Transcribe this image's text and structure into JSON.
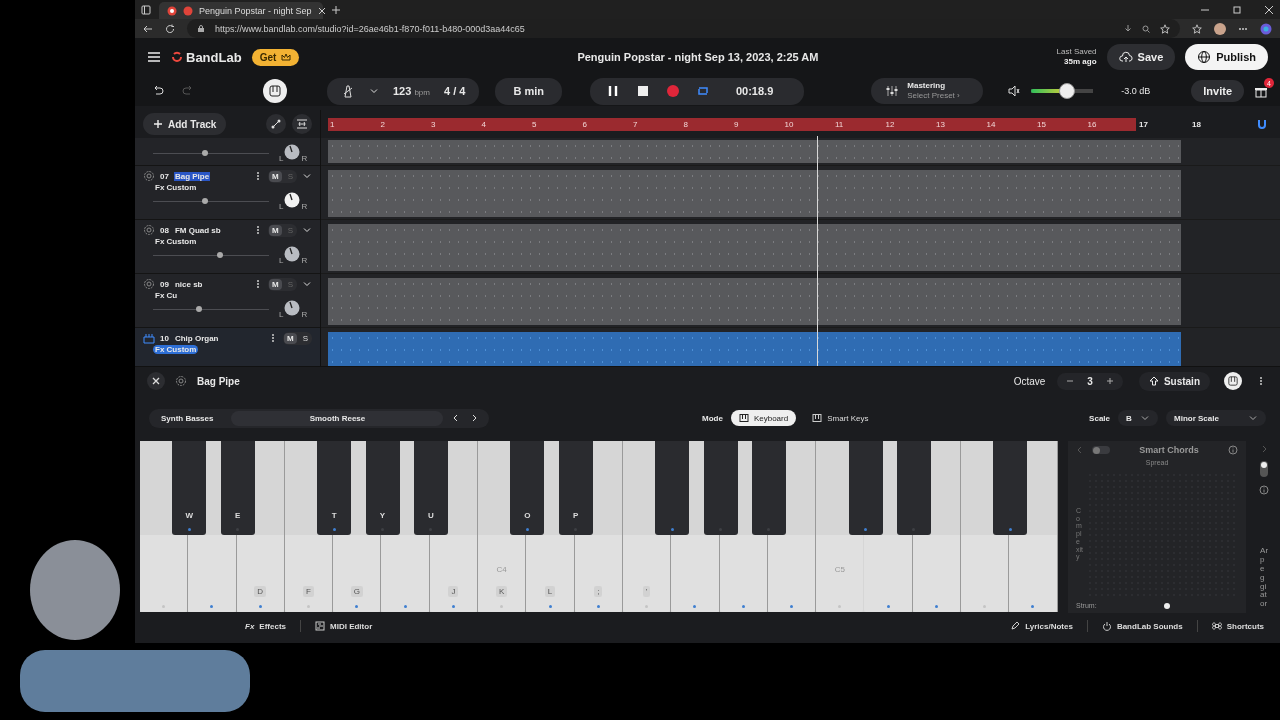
{
  "browser": {
    "tab_title": "Penguin Popstar - night Sep",
    "url": "https://www.bandlab.com/studio?id=26ae46b1-f870-f011-b480-000d3aa44c65"
  },
  "header": {
    "brand": "BandLab",
    "get_badge": "Get",
    "title": "Penguin Popstar - night Sep 13, 2023, 2:25 AM",
    "last_saved_label": "Last Saved",
    "last_saved_time": "35m ago",
    "save": "Save",
    "publish": "Publish"
  },
  "transport": {
    "tempo": "123",
    "tempo_unit": "bpm",
    "time_signature": "4 / 4",
    "key": "B min",
    "playing": true,
    "loop": true,
    "time": "00:18.9",
    "mastering_title": "Mastering",
    "mastering_preset": "Select Preset ›",
    "volume": {
      "level": 0.58
    },
    "volume_reading": "-3.0 dB",
    "invite": "Invite",
    "notification_count": "4"
  },
  "add_track": "Add Track",
  "tracks": [
    {
      "selected": false,
      "level": 0.45,
      "pan_left": "L",
      "pan_right": "R"
    },
    {
      "kind": "synth",
      "number": "07",
      "name": "Bag Pipe",
      "name_highlighted": true,
      "fx": "Fx Custom",
      "mute": "M",
      "solo": "S",
      "selected": false,
      "level": 0.45,
      "pan_left": "L",
      "pan_right": "R"
    },
    {
      "kind": "synth",
      "number": "08",
      "name": "FM Quad sb",
      "name_highlighted": false,
      "fx": "Fx Custom",
      "mute": "M",
      "solo": "S",
      "selected": false,
      "level": 0.58,
      "pan_left": "L",
      "pan_right": "R"
    },
    {
      "kind": "synth",
      "number": "09",
      "name": "nice sb",
      "name_highlighted": false,
      "fx": "Fx Cu",
      "mute": "M",
      "solo": "S",
      "selected": false,
      "level": 0.4,
      "pan_left": "L",
      "pan_right": "R"
    },
    {
      "kind": "instrument",
      "number": "10",
      "name": "Chip Organ",
      "name_highlighted": false,
      "fx": "Fx Custom",
      "mute": "M",
      "solo": "S",
      "selected": true
    }
  ],
  "ruler": {
    "loop": true,
    "bars": [
      "1",
      "2",
      "3",
      "4",
      "5",
      "6",
      "7",
      "8",
      "9",
      "10",
      "11",
      "12",
      "13",
      "14",
      "15",
      "16"
    ],
    "after": [
      "17",
      "18"
    ]
  },
  "instrument_panel": {
    "name": "Bag Pipe",
    "octave_label": "Octave",
    "octave": "3",
    "sustain": "Sustain",
    "preset_category": "Synth Basses",
    "preset": "Smooth Reese",
    "mode_label": "Mode",
    "modes": [
      {
        "label": "Keyboard",
        "selected": true
      },
      {
        "label": "Smart Keys",
        "selected": false
      }
    ],
    "scale_label": "Scale",
    "scale_root": "B",
    "scale_type": "Minor Scale"
  },
  "keyboard": [
    {
      "in_scale": false,
      "sharp": {
        "label": "W",
        "in_scale": true
      }
    },
    {
      "in_scale": true,
      "sharp": {
        "label": "E",
        "in_scale": false
      }
    },
    {
      "label": "D",
      "in_scale": true
    },
    {
      "label": "F",
      "in_scale": false,
      "sharp": {
        "label": "T",
        "in_scale": true
      }
    },
    {
      "label": "G",
      "in_scale": true,
      "sharp": {
        "label": "Y",
        "in_scale": false
      }
    },
    {
      "in_scale": true,
      "sharp": {
        "label": "U",
        "in_scale": false
      }
    },
    {
      "label": "J",
      "in_scale": true
    },
    {
      "label": "K",
      "note": "C4",
      "in_scale": false,
      "sharp": {
        "label": "O",
        "in_scale": true
      }
    },
    {
      "label": "L",
      "in_scale": true,
      "sharp": {
        "label": "P",
        "in_scale": false
      }
    },
    {
      "label": ";",
      "in_scale": true
    },
    {
      "label": "'",
      "in_scale": false,
      "sharp": {
        "in_scale": true
      }
    },
    {
      "in_scale": true,
      "sharp": {
        "in_scale": false
      }
    },
    {
      "in_scale": true,
      "sharp": {
        "in_scale": false
      }
    },
    {
      "in_scale": true
    },
    {
      "note": "C5",
      "in_scale": false,
      "sharp": {
        "in_scale": true
      }
    },
    {
      "in_scale": true,
      "sharp": {
        "in_scale": false
      }
    },
    {
      "in_scale": true
    },
    {
      "in_scale": false,
      "sharp": {
        "in_scale": true
      }
    },
    {
      "in_scale": true
    }
  ],
  "smart_chords": {
    "title": "Smart Chords",
    "enabled": false,
    "spread_label": "Spread",
    "complexity_label": "Complexity",
    "strum_label": "Strum:",
    "arpeggiator_label": "Arpeggiator",
    "arpeggiator_on": false
  },
  "footer": {
    "left": [
      {
        "kind": "effects",
        "label": "Effects",
        "icon_text": "Fx"
      },
      {
        "kind": "midi",
        "label": "MIDI Editor"
      }
    ],
    "right": [
      {
        "kind": "lyrics",
        "label": "Lyrics/Notes"
      },
      {
        "kind": "sounds",
        "label": "BandLab Sounds"
      },
      {
        "kind": "shortcuts",
        "label": "Shortcuts"
      }
    ]
  }
}
